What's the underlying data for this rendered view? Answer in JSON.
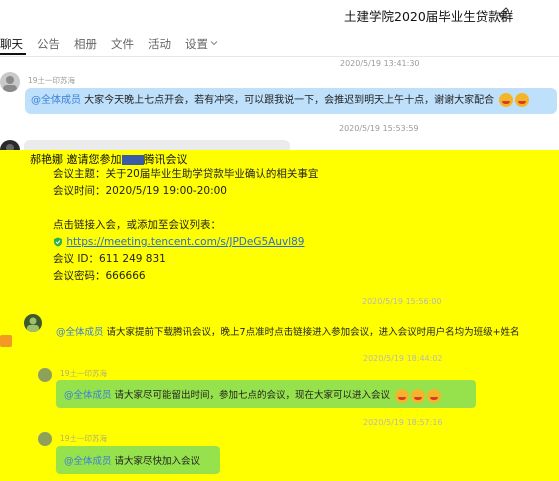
{
  "header": {
    "title": "土建学院2020届毕业生贷款群",
    "tabs": [
      "聊天",
      "公告",
      "相册",
      "文件",
      "活动",
      "设置"
    ]
  },
  "messages": {
    "ts1": "2020/5/19 13:41:30",
    "sender1": "19土一印苏海",
    "msg1_mention": "@全体成员",
    "msg1_text": " 大家今天晚上七点开会，若有冲突，可以跟我说一下，会推迟到明天上午十点，谢谢大家配合",
    "ts2": "2020/5/19 15:53:59",
    "invite_sender": "郝艳娜",
    "invite_text_a": " 邀请您参加",
    "invite_text_b": "腾讯会议",
    "meeting": {
      "topic": "会议主题：关于20届毕业生助学贷款毕业确认的相关事宜",
      "time": "会议时间：2020/5/19 19:00-20:00",
      "blank": "",
      "join_hint": "点击链接入会，或添加至会议列表：",
      "link": "https://meeting.tencent.com/s/JPDeG5Auvl89",
      "id": "会议 ID：611 249 831",
      "password": "会议密码：666666"
    },
    "ts3": "2020/5/19 15:56:00",
    "msg3_mention": "@全体成员",
    "msg3_text": " 请大家提前下载腾讯会议，晚上7点准时点击链接进入参加会议，进入会议时用户名均为班级+姓名",
    "ts4": "2020/5/19 18:44:02",
    "sender4": "19土一印苏海",
    "msg4_mention": "@全体成员",
    "msg4_text": " 请大家尽可能留出时间，参加七点的会议，现在大家可以进入会议",
    "ts5": "2020/5/19 18:57:16",
    "sender5": "19土一印苏海",
    "msg5_mention": "@全体成员",
    "msg5_text": " 请大家尽快加入会议"
  },
  "colors": {
    "highlight": "#ffff00",
    "blue_bubble": "#bfe0fb",
    "green_bubble": "#96e24c",
    "mention": "#3a7fd8"
  }
}
